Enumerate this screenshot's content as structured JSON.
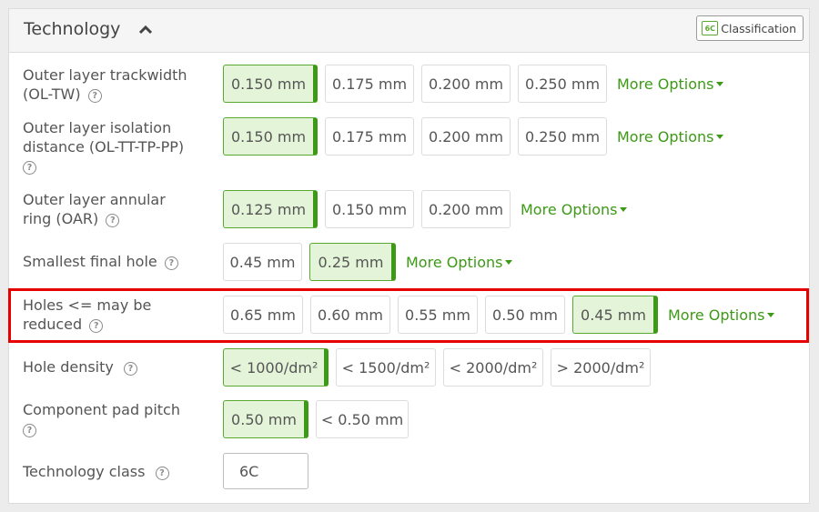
{
  "header": {
    "title": "Technology",
    "classification_label": "Classification",
    "classification_badge": "6C"
  },
  "colors": {
    "accent": "#3c9a16",
    "selected_bg": "#e4f4d9",
    "highlight": "#e60000"
  },
  "rows": [
    {
      "label_lines": [
        "Outer layer trackwidth",
        "(OL-TW)"
      ],
      "options": [
        "0.150 mm",
        "0.175 mm",
        "0.200 mm",
        "0.250 mm"
      ],
      "selected": "0.150 mm",
      "more": "More Options"
    },
    {
      "label_lines": [
        "Outer layer isolation",
        "distance (OL-TT-TP-PP)",
        ""
      ],
      "options": [
        "0.150 mm",
        "0.175 mm",
        "0.200 mm",
        "0.250 mm"
      ],
      "selected": "0.150 mm",
      "more": "More Options"
    },
    {
      "label_lines": [
        "Outer layer annular",
        "ring (OAR)"
      ],
      "options": [
        "0.125 mm",
        "0.150 mm",
        "0.200 mm"
      ],
      "selected": "0.125 mm",
      "more": "More Options"
    },
    {
      "label_lines": [
        "Smallest final hole"
      ],
      "options": [
        "0.45 mm",
        "0.25 mm"
      ],
      "selected": "0.25 mm",
      "more": "More Options"
    },
    {
      "label_lines": [
        "Holes <= may be",
        "reduced"
      ],
      "options": [
        "0.65 mm",
        "0.60 mm",
        "0.55 mm",
        "0.50 mm",
        "0.45 mm"
      ],
      "selected": "0.45 mm",
      "more": "More Options"
    },
    {
      "label_lines": [
        "Hole density"
      ],
      "options": [
        "< 1000/dm²",
        "< 1500/dm²",
        "< 2000/dm²",
        "> 2000/dm²"
      ],
      "selected": "< 1000/dm²"
    },
    {
      "label_lines": [
        "Component pad pitch",
        ""
      ],
      "options": [
        "0.50 mm",
        "< 0.50 mm"
      ],
      "selected": "0.50 mm"
    },
    {
      "label_lines": [
        "Technology class"
      ],
      "value": "6C"
    }
  ]
}
